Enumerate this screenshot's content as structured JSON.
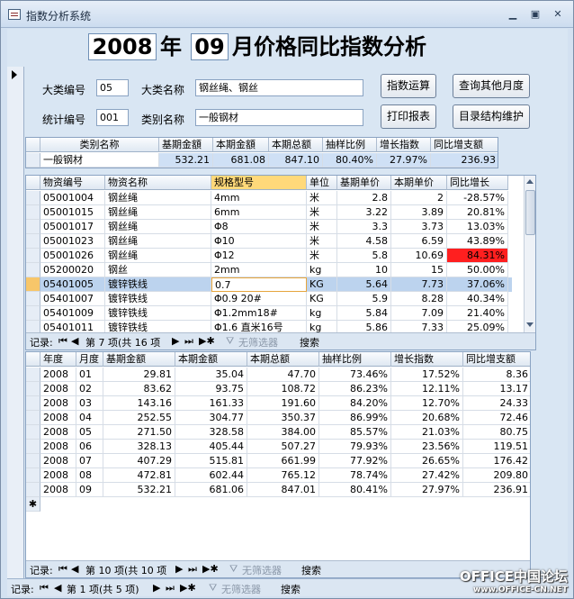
{
  "window": {
    "title": "指数分析系统"
  },
  "header": {
    "year": "2008",
    "year_char": "年",
    "month": "09",
    "title_rest": "月价格同比指数分析"
  },
  "form": {
    "category_no_label": "大类编号",
    "category_no": "05",
    "category_name_label": "大类名称",
    "category_name": "钢丝绳、钢丝",
    "stat_no_label": "统计编号",
    "stat_no": "001",
    "class_name_label": "类别名称",
    "class_name": "一般钢材"
  },
  "buttons": {
    "compute": "指数运算",
    "query_other": "查询其他月度",
    "print": "打印报表",
    "catalog": "目录结构维护"
  },
  "summary": {
    "columns": [
      "类别名称",
      "基期金額",
      "本期金額",
      "本期总额",
      "抽样比例",
      "增长指数",
      "同比增支额"
    ],
    "row": [
      "一般钢材",
      "532.21",
      "681.08",
      "847.10",
      "80.40%",
      "27.97%",
      "236.93"
    ]
  },
  "items": {
    "columns": [
      "物资编号",
      "物资名称",
      "规格型号",
      "单位",
      "基期单价",
      "本期单价",
      "同比增长"
    ],
    "rows": [
      [
        "05001004",
        "钢丝绳",
        "4mm",
        "米",
        "2.8",
        "2",
        "-28.57%"
      ],
      [
        "05001015",
        "钢丝绳",
        "6mm",
        "米",
        "3.22",
        "3.89",
        "20.81%"
      ],
      [
        "05001017",
        "钢丝绳",
        "Φ8",
        "米",
        "3.3",
        "3.73",
        "13.03%"
      ],
      [
        "05001023",
        "钢丝绳",
        "Φ10",
        "米",
        "4.58",
        "6.59",
        "43.89%"
      ],
      [
        "05001026",
        "钢丝绳",
        "Φ12",
        "米",
        "5.8",
        "10.69",
        "84.31%"
      ],
      [
        "05200020",
        "钢丝",
        "2mm",
        "kg",
        "10",
        "15",
        "50.00%"
      ],
      [
        "05401005",
        "镀锌铁线",
        "0.7",
        "KG",
        "5.64",
        "7.73",
        "37.06%"
      ],
      [
        "05401007",
        "镀锌铁线",
        "Φ0.9 20#",
        "KG",
        "5.9",
        "8.28",
        "40.34%"
      ],
      [
        "05401009",
        "镀锌铁线",
        "Φ1.2mm18#",
        "kg",
        "5.84",
        "7.09",
        "21.40%"
      ],
      [
        "05401011",
        "镀锌铁线",
        "Φ1.6 直米16号",
        "kg",
        "5.86",
        "7.33",
        "25.09%"
      ]
    ],
    "nav": {
      "record_label": "记录:",
      "position": "第 7 项(共 16 项",
      "filter": "无筛选器",
      "search": "搜索"
    }
  },
  "history": {
    "columns": [
      "年度",
      "月度",
      "基期金额",
      "本期金额",
      "本期总额",
      "抽样比例",
      "增长指数",
      "同比增支额"
    ],
    "rows": [
      [
        "2008",
        "01",
        "29.81",
        "35.04",
        "47.70",
        "73.46%",
        "17.52%",
        "8.36"
      ],
      [
        "2008",
        "02",
        "83.62",
        "93.75",
        "108.72",
        "86.23%",
        "12.11%",
        "13.17"
      ],
      [
        "2008",
        "03",
        "143.16",
        "161.33",
        "191.60",
        "84.20%",
        "12.70%",
        "24.33"
      ],
      [
        "2008",
        "04",
        "252.55",
        "304.77",
        "350.37",
        "86.99%",
        "20.68%",
        "72.46"
      ],
      [
        "2008",
        "05",
        "271.50",
        "328.58",
        "384.00",
        "85.57%",
        "21.03%",
        "80.75"
      ],
      [
        "2008",
        "06",
        "328.13",
        "405.44",
        "507.27",
        "79.93%",
        "23.56%",
        "119.51"
      ],
      [
        "2008",
        "07",
        "407.29",
        "515.81",
        "661.99",
        "77.92%",
        "26.65%",
        "176.42"
      ],
      [
        "2008",
        "08",
        "472.81",
        "602.44",
        "765.12",
        "78.74%",
        "27.42%",
        "209.80"
      ],
      [
        "2008",
        "09",
        "532.21",
        "681.06",
        "847.01",
        "80.41%",
        "27.97%",
        "236.91"
      ]
    ],
    "new_row_marker": "✱",
    "nav": {
      "record_label": "记录:",
      "position": "第 10 项(共 10 项",
      "filter": "无筛选器",
      "search": "搜索"
    }
  },
  "statusbar": {
    "record_label": "记录:",
    "position": "第 1 项(共 5 项)",
    "filter": "无筛选器",
    "search": "搜索"
  },
  "watermark": {
    "line1": "OFFICE中国论坛",
    "line2": "www.OFFICE-CN.NET"
  },
  "colors": {
    "highlight_cell": "#ff1f1f",
    "selected_row": "#bcd3ee",
    "active_col_header": "#ffd97a"
  }
}
